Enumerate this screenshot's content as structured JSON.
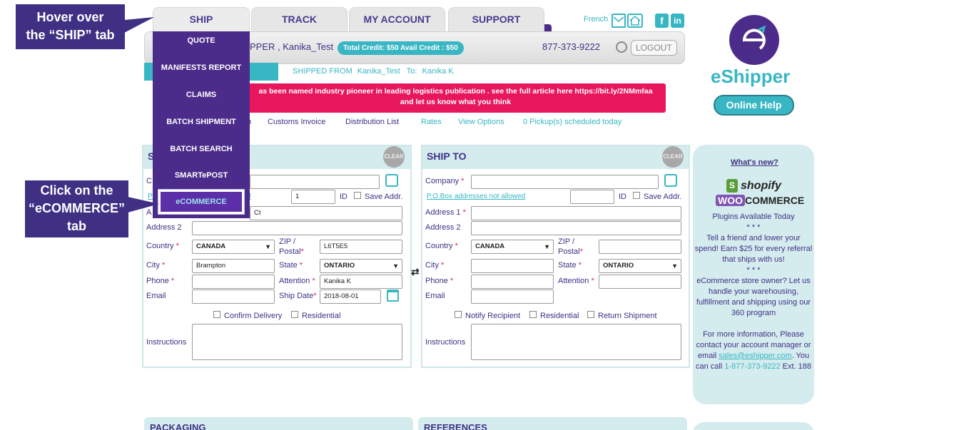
{
  "nav": {
    "tabs": [
      "SHIP",
      "TRACK",
      "MY ACCOUNT",
      "SUPPORT"
    ],
    "french_label": "French"
  },
  "header": {
    "user_text": "PPER , Kanika_Test",
    "credit_text": "Total Credit: $50  Avail Credit : $50",
    "phone": "877-373-9222",
    "logout_label": "LOGOUT",
    "shipped_from_label": "SHIPPED FROM",
    "shipped_from_value": "Kanika_Test",
    "to_label": "To:",
    "to_value": "Kanika K"
  },
  "announcement": {
    "line1": "as been named industry pioneer in leading logistics publication . see the full article here https://bit.ly/2NMmfaa",
    "line2": "and let us know what you think"
  },
  "subnav": {
    "partial": "n",
    "customs_invoice": "Customs Invoice",
    "distribution_list": "Distribution List",
    "rates": "Rates",
    "view_options": "View Options",
    "pickups": "0 Pickup(s) scheduled today"
  },
  "ship_dropdown": {
    "items": [
      "QUOTE",
      "MANIFESTS REPORT",
      "CLAIMS",
      "BATCH SHIPMENT",
      "BATCH SEARCH",
      "SMARTePOST",
      "eCOMMERCE"
    ]
  },
  "callouts": {
    "hover_line1": "Hover over",
    "hover_line2": "the “SHIP” tab",
    "click_line1": "Click on the",
    "click_line2": "“eCOMMERCE”",
    "click_line3": "tab"
  },
  "ship_from": {
    "title_partial": "S",
    "clear_label": "CLEAR",
    "partial_company": "C",
    "partial_pobox": "P",
    "partial_pobox_tail": "d",
    "partial_address1": "A",
    "id_value": "1",
    "id_label": "ID",
    "save_addr_label": "Save Addr.",
    "address1_value": "Ct",
    "address2_label": "Address 2",
    "country_label": "Country",
    "country_value": "CANADA",
    "zip_label": "ZIP /",
    "postal_label": "Postal",
    "zip_value": "L6T5E5",
    "city_label": "City",
    "city_value": "Brampton",
    "state_label": "State",
    "state_value": "ONTARIO",
    "phone_label": "Phone",
    "attention_label": "Attention",
    "attention_value": "Kanika K",
    "email_label": "Email",
    "ship_date_label": "Ship Date",
    "ship_date_value": "2018-08-01",
    "confirm_delivery_label": "Confirm Delivery",
    "residential_label": "Residential",
    "instructions_label": "Instructions"
  },
  "ship_to": {
    "title": "SHIP TO",
    "clear_label": "CLEAR",
    "company_label": "Company",
    "pobox_link": "P.O.Box addresses not allowed",
    "id_label": "ID",
    "save_addr_label": "Save Addr.",
    "address1_label": "Address 1",
    "address2_label": "Address 2",
    "country_label": "Country",
    "country_value": "CANADA",
    "zip_label": "ZIP /",
    "postal_label": "Postal",
    "city_label": "City",
    "state_label": "State",
    "state_value": "ONTARIO",
    "phone_label": "Phone",
    "attention_label": "Attention",
    "email_label": "Email",
    "notify_label": "Notify Recipient",
    "residential_label": "Residential",
    "return_label": "Return Shipment",
    "instructions_label": "Instructions"
  },
  "sidebar": {
    "brand": "eShipper",
    "online_help": "Online Help",
    "whats_new": "What's new?",
    "shopify": "shopify",
    "woo": "WOO",
    "commerce": "COMMERCE",
    "plugins": "Plugins Available Today",
    "stars1": "* * *",
    "refer_text": "Tell a friend and lower your spend! Earn $25 for every referral that ships with us!",
    "stars2": "* * *",
    "ecommerce_text": "eCommerce store owner? Let us handle your warehousing, fulfillment and shipping using our 360 program",
    "info_prefix": "For more information, Please contact your account manager or email",
    "info_email": "sales@eshipper.com",
    "info_call": "You can call",
    "info_phone": "1-877-373-9222",
    "info_ext": "Ext. 188"
  },
  "bottom": {
    "packaging": "PACKAGING",
    "references": "REFERENCES"
  },
  "colors": {
    "brand_purple": "#4b2c8a",
    "teal": "#38b6c3",
    "alert_red": "#e8175d",
    "panel_bg": "#d5ecee"
  }
}
